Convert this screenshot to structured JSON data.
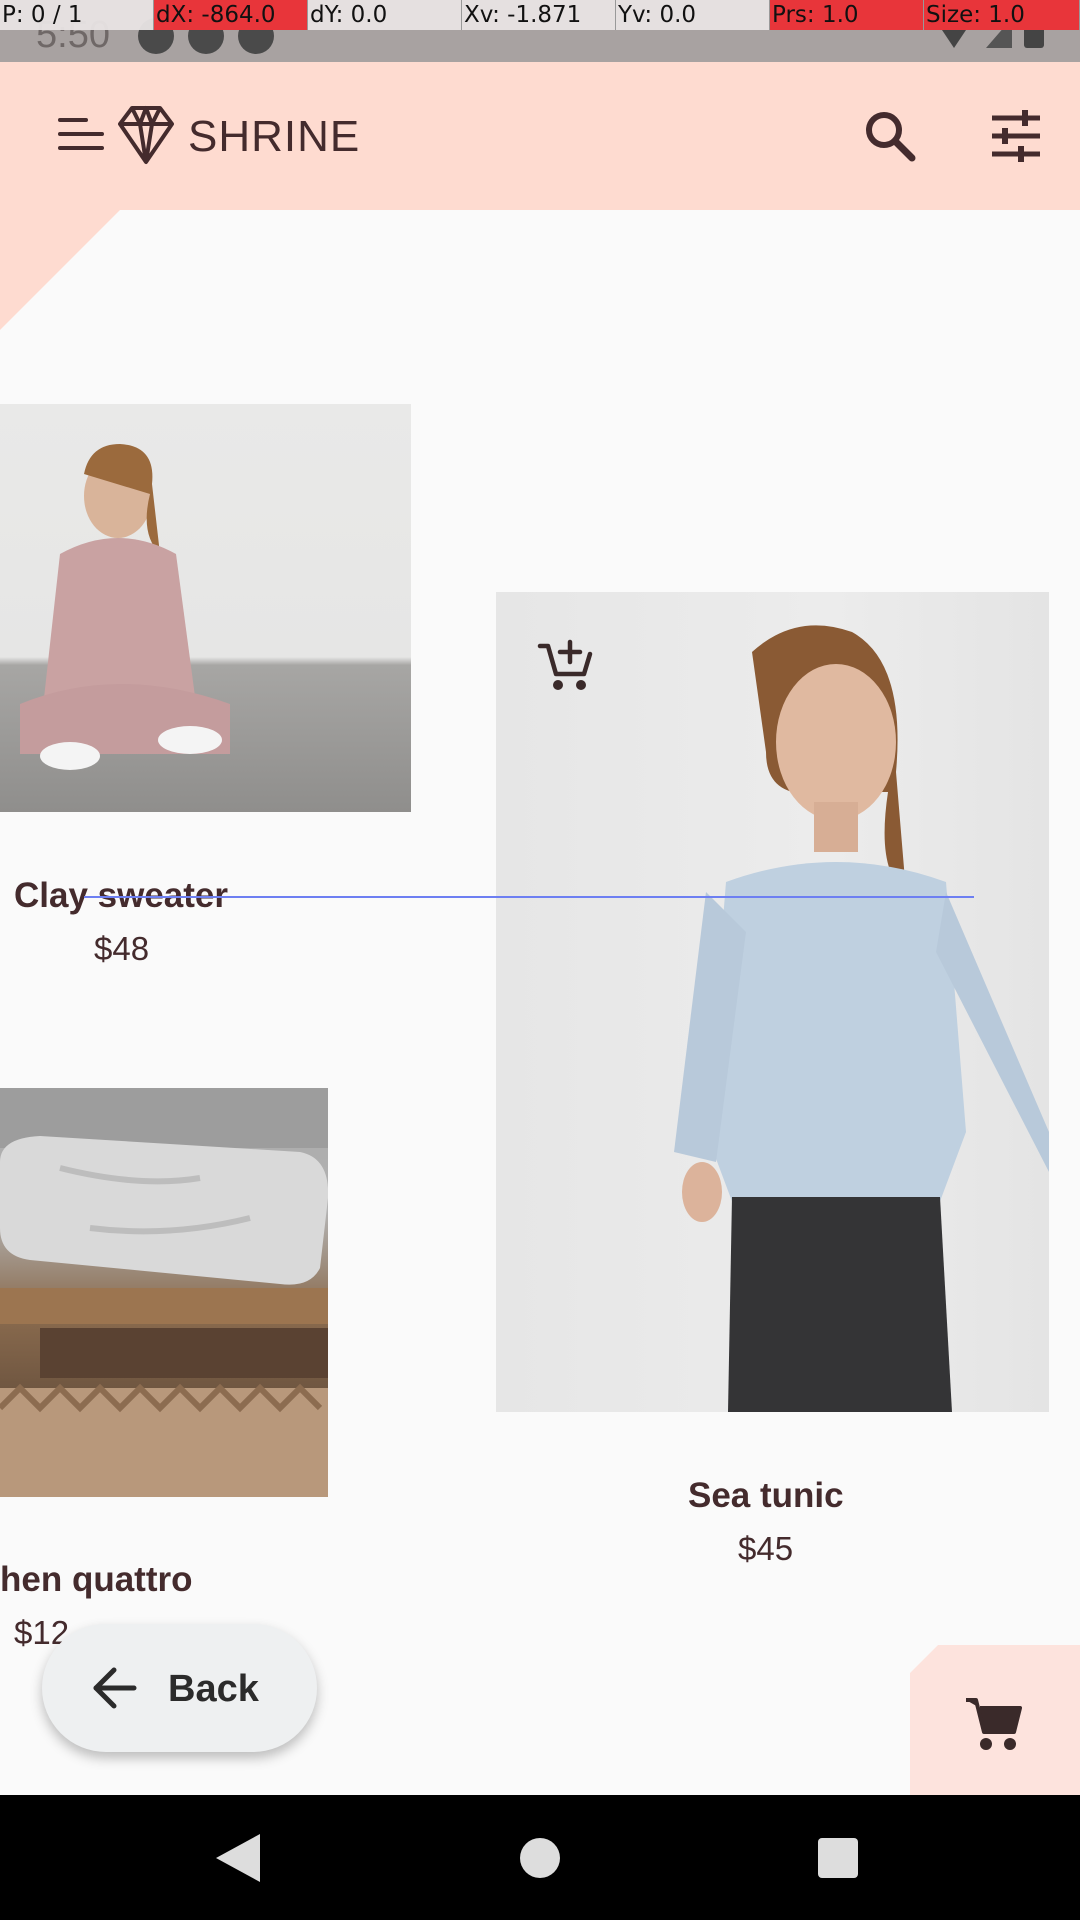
{
  "status_bar": {
    "time": "5:50"
  },
  "pointer_overlay": {
    "pointer": "P: 0 / 1",
    "dx": "dX: -864.0",
    "dy": "dY: 0.0",
    "xv": "Xv: -1.871",
    "yv": "Yv: 0.0",
    "pressure": "Prs: 1.0",
    "size": "Size: 1.0"
  },
  "app_bar": {
    "title": "SHRINE"
  },
  "products": [
    {
      "name": "Clay sweater",
      "price": "$48"
    },
    {
      "name": "Sea tunic",
      "price": "$45"
    },
    {
      "name": "hen quattro",
      "price": "$12"
    }
  ],
  "back_button": {
    "label": "Back"
  },
  "colors": {
    "app_bar_bg": "#fedbd0",
    "text": "#442b2d",
    "overlay_red": "#e8353a"
  }
}
